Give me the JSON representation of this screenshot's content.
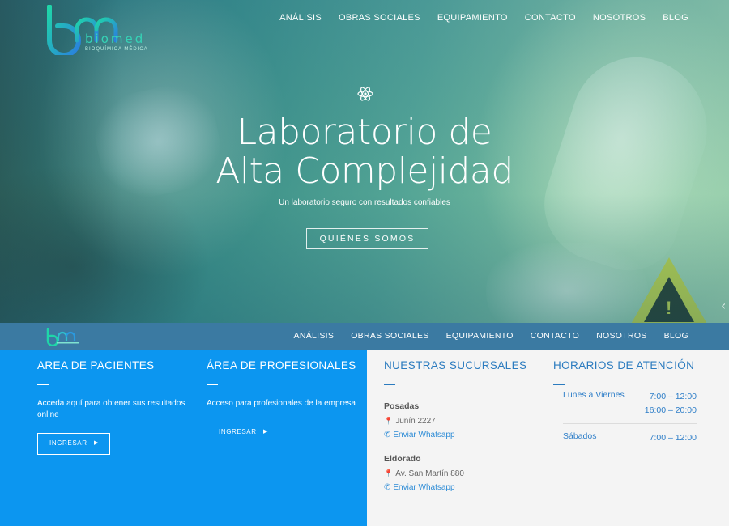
{
  "brand": {
    "name": "biomed",
    "tagline": "BIOQUÍMICA MÉDICA",
    "mark_color": "#35d3b6"
  },
  "nav": {
    "items": [
      "ANÁLISIS",
      "OBRAS SOCIALES",
      "EQUIPAMIENTO",
      "CONTACTO",
      "NOSOTROS",
      "BLOG"
    ]
  },
  "hero": {
    "icon": "atom-icon",
    "title_line1": "Laboratorio de",
    "title_line2": "Alta Complejidad",
    "subtitle": "Un laboratorio seguro con resultados confiables",
    "button": "QUIÉNES SOMOS"
  },
  "patients": {
    "heading": "AREA DE PACIENTES",
    "text": "Acceda aquí para obtener sus resultados online",
    "button": "INGRESAR"
  },
  "professionals": {
    "heading": "ÁREA DE PROFESIONALES",
    "text": "Acceso para profesionales de la empresa",
    "button": "INGRESAR"
  },
  "branches": {
    "heading": "NUESTRAS SUCURSALES",
    "items": [
      {
        "name": "Posadas",
        "address": "Junín 2227",
        "whatsapp": "Enviar Whatsapp"
      },
      {
        "name": "Eldorado",
        "address": "Av. San Martín 880",
        "whatsapp": "Enviar Whatsapp"
      }
    ]
  },
  "hours": {
    "heading": "HORARIOS DE ATENCIÓN",
    "rows": [
      {
        "day": "Lunes a Viernes",
        "times": [
          "7:00 – 12:00",
          "16:00 – 20:00"
        ]
      },
      {
        "day": "Sábados",
        "times": [
          "7:00 – 12:00"
        ]
      }
    ]
  },
  "colors": {
    "blue_panel": "#0c96f0",
    "sticky_bar": "#3b7aa2",
    "heading_blue": "#2b7bbf",
    "link_blue": "#2e8cd6"
  }
}
